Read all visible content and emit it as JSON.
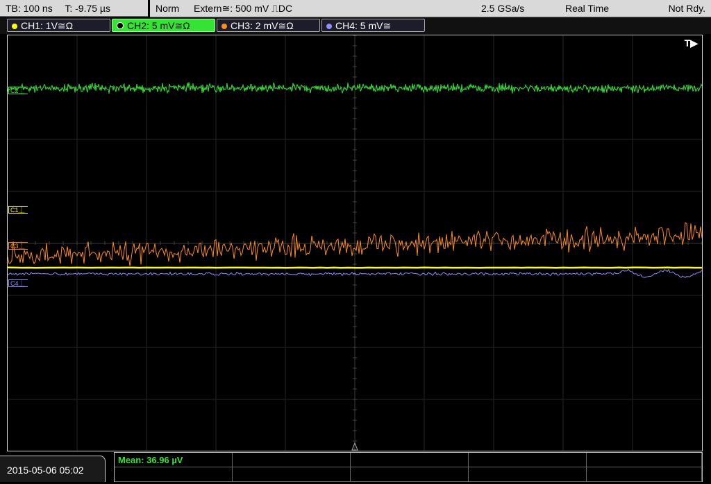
{
  "header": {
    "timebase": "TB: 100 ns",
    "trigger_time": "T: -9.75 µs",
    "trigger_mode": "Norm",
    "trigger_source": "Extern≅: 500 mV ⎍DC",
    "sample_rate": "2.5 GSa/s",
    "acq_mode": "Real Time",
    "status": "Not Rdy."
  },
  "channels": [
    {
      "label": "CH1: 1V≅Ω",
      "color": "#ffff00",
      "marker": "C1⏊",
      "active": false
    },
    {
      "label": "CH2: 5 mV≅Ω",
      "color": "#35e335",
      "marker": "C2⏊",
      "active": true
    },
    {
      "label": "CH3: 2 mV≅Ω",
      "color": "#ff8c1a",
      "marker": "C3⏊",
      "active": false
    },
    {
      "label": "CH4: 5 mV≅",
      "color": "#8f8fff",
      "marker": "C4⏊",
      "active": false
    }
  ],
  "trigger_marker": "T▶",
  "footer": {
    "datetime": "2015-05-06 05:02",
    "measurement": "Mean: 36.96 µV"
  }
}
